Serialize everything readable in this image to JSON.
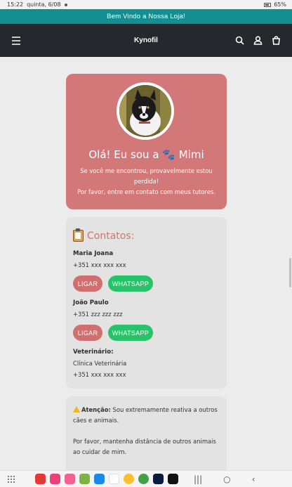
{
  "status_bar": {
    "time": "15:22",
    "date": "quinta, 6/08",
    "battery": "65%"
  },
  "announcement": "Bem Vindo a Nossa Loja!",
  "header": {
    "brand": "Kynofil",
    "icons": [
      "menu-icon",
      "search-icon",
      "account-icon",
      "bag-icon"
    ]
  },
  "profile": {
    "greeting": "Olá! Eu sou a 🐾 Mimi",
    "message_line1": "Se você me encontrou, provavelmente estou perdida!",
    "message_line2": "Por favor, entre em contato com meus tutores."
  },
  "contacts": {
    "title": "Contatos:",
    "people": [
      {
        "name": "Maria Joana",
        "phone": "+351 xxx xxx xxx",
        "call_label": "LIGAR",
        "whatsapp_label": "WHATSAPP"
      },
      {
        "name": "João Paulo",
        "phone": "+351 zzz zzz zzz",
        "call_label": "LIGAR",
        "whatsapp_label": "WHATSAPP"
      }
    ],
    "vet": {
      "label": "Veterinário:",
      "clinic": "Clínica Veterinária",
      "phone": "+351 xxx xxx xxx"
    }
  },
  "warning": {
    "label": "Atenção:",
    "text1": "Sou extremamente reativa a outros cães e animais.",
    "text2": "Por favor, mantenha distância de outros animais ao cuidar de mim."
  },
  "colors": {
    "announcement_bg": "#138f91",
    "header_bg": "#25292d",
    "profile_bg": "#d37878",
    "call_btn": "#cf6f6f",
    "whatsapp_btn": "#27c36a"
  }
}
